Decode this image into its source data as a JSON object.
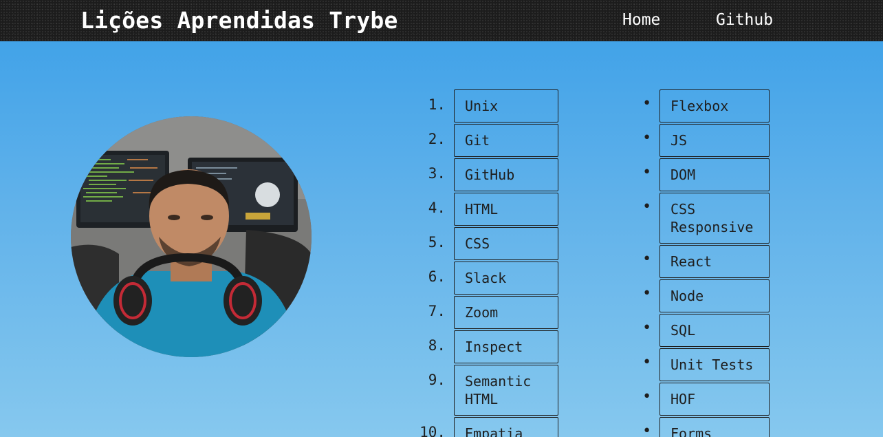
{
  "header": {
    "title": "Lições Aprendidas Trybe",
    "nav": [
      {
        "label": "Home"
      },
      {
        "label": "Github"
      }
    ]
  },
  "profile": {
    "photo_alt": "profile photo"
  },
  "ordered_list": {
    "items": [
      {
        "marker": "1.",
        "label": "Unix"
      },
      {
        "marker": "2.",
        "label": "Git"
      },
      {
        "marker": "3.",
        "label": "GitHub"
      },
      {
        "marker": "4.",
        "label": "HTML"
      },
      {
        "marker": "5.",
        "label": "CSS"
      },
      {
        "marker": "6.",
        "label": "Slack"
      },
      {
        "marker": "7.",
        "label": "Zoom"
      },
      {
        "marker": "8.",
        "label": "Inspect"
      },
      {
        "marker": "9.",
        "label": "Semantic HTML"
      },
      {
        "marker": "10.",
        "label": "Empatia"
      }
    ]
  },
  "unordered_list": {
    "bullet": "•",
    "items": [
      {
        "label": "Flexbox"
      },
      {
        "label": "JS"
      },
      {
        "label": "DOM"
      },
      {
        "label": "CSS Responsive"
      },
      {
        "label": "React"
      },
      {
        "label": "Node"
      },
      {
        "label": "SQL"
      },
      {
        "label": "Unit Tests"
      },
      {
        "label": "HOF"
      },
      {
        "label": "Forms"
      }
    ]
  },
  "colors": {
    "header_bg": "#1c1c1c",
    "page_gradient_top": "#3a9fe8",
    "page_gradient_bottom": "#86c8ee",
    "text": "#1e1e1e",
    "header_text": "#ffffff"
  }
}
